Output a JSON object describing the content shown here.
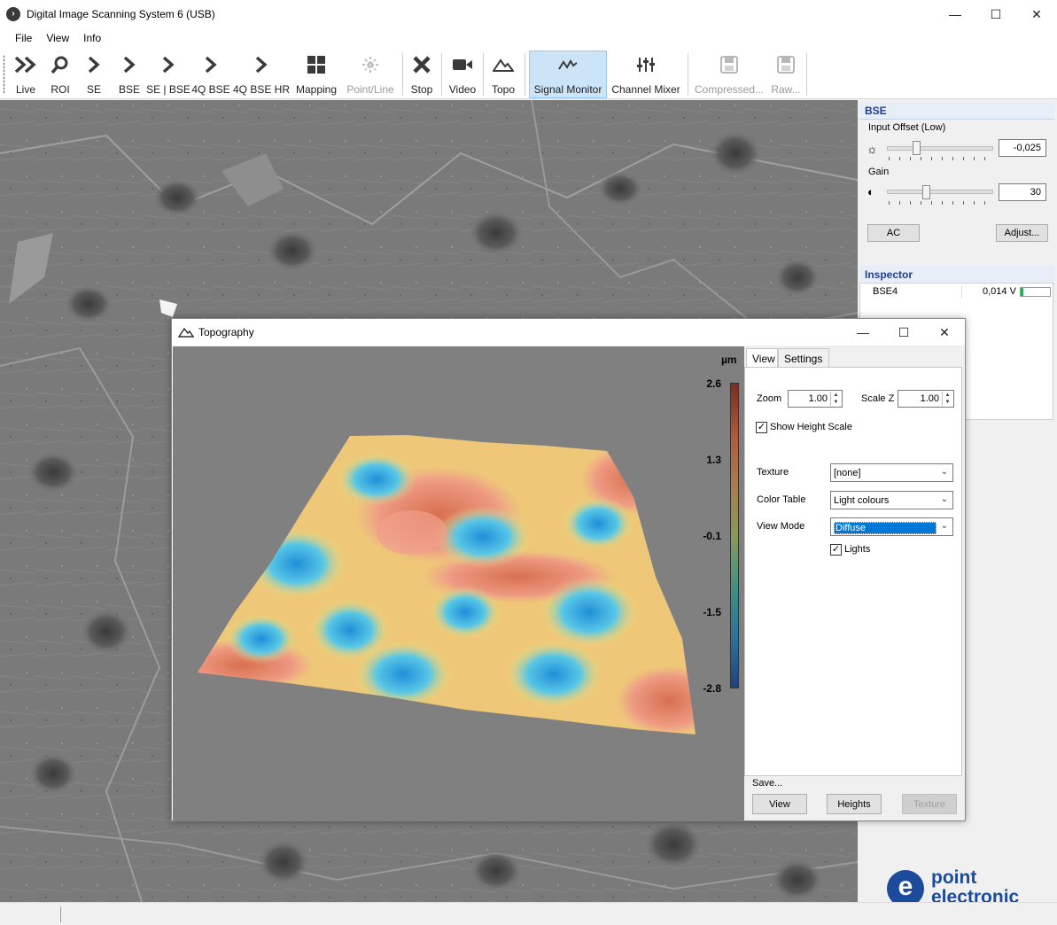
{
  "window": {
    "title": "Digital Image Scanning System 6 (USB)",
    "minimize": "—",
    "maximize": "☐",
    "close": "✕"
  },
  "menu": [
    "File",
    "View",
    "Info"
  ],
  "toolbar": {
    "live": "Live",
    "roi": "ROI",
    "se": "SE",
    "bse": "BSE",
    "se_bse": "SE | BSE",
    "bse4q": "4Q BSE",
    "bse4q_hr": "4Q BSE HR",
    "mapping": "Mapping",
    "point_line": "Point/Line",
    "stop": "Stop",
    "video": "Video",
    "topo": "Topo",
    "signal_monitor": "Signal Monitor",
    "channel_mixer": "Channel Mixer",
    "compressed": "Compressed...",
    "raw": "Raw..."
  },
  "bse_panel": {
    "title": "BSE",
    "input_offset_label": "Input Offset (Low)",
    "input_offset_value": "-0,025",
    "gain_label": "Gain",
    "gain_value": "30",
    "ac_button": "AC",
    "adjust_button": "Adjust..."
  },
  "inspector": {
    "title": "Inspector",
    "rows": [
      {
        "channel": "BSE4",
        "value": "0,014 V",
        "level": 0.1
      }
    ]
  },
  "logo": {
    "line1": "point",
    "line2": "electronic"
  },
  "topography": {
    "title": "Topography",
    "unit": "µm",
    "scale": [
      "2.6",
      "1.3",
      "-0.1",
      "-1.5",
      "-2.8"
    ],
    "tabs": [
      "View",
      "Settings"
    ],
    "zoom_label": "Zoom",
    "zoom_value": "1.00",
    "scalez_label": "Scale Z",
    "scalez_value": "1.00",
    "show_height_scale": "Show Height Scale",
    "texture_label": "Texture",
    "texture_value": "[none]",
    "color_table_label": "Color Table",
    "color_table_value": "Light colours",
    "view_mode_label": "View Mode",
    "view_mode_value": "Diffuse",
    "lights": "Lights",
    "save_label": "Save...",
    "view_button": "View",
    "heights_button": "Heights",
    "texture_button": "Texture"
  },
  "colors": {
    "accent": "#1f3f8f",
    "logo": "#1d4b9c",
    "selection": "#0078d7"
  }
}
